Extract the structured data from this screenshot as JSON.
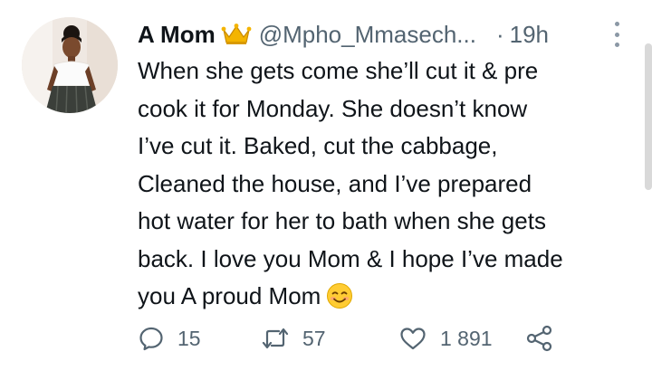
{
  "tweet": {
    "author_name": "A Mom",
    "badge_icon": "crown-emoji",
    "handle": "@Mpho_Mmasech...",
    "dot": "·",
    "time": "19h",
    "text_lines": [
      "When she gets come she’ll cut it & pre",
      "cook it for Monday. She doesn’t know",
      "I’ve cut it. Baked, cut the cabbage,",
      "Cleaned the house, and I’ve prepared",
      "hot water for her to bath when she gets",
      "back. I love you Mom & I hope I’ve made",
      "you A proud Mom"
    ],
    "trailing_emoji": "smiling-face-emoji"
  },
  "actions": {
    "reply_count": "15",
    "retweet_count": "57",
    "like_count": "1 891"
  },
  "colors": {
    "text": "#0f1419",
    "secondary": "#536471",
    "crown": "#f4b400"
  }
}
